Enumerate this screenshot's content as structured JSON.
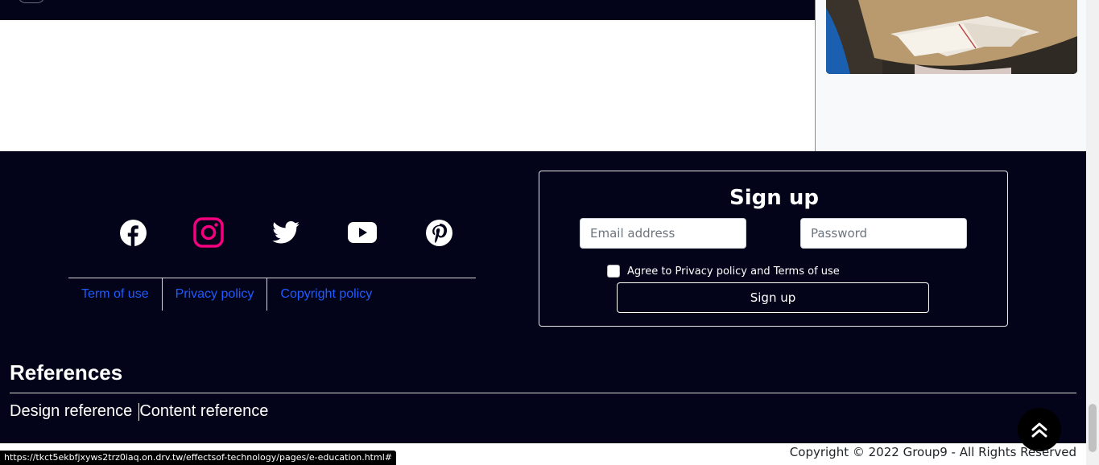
{
  "header": {
    "logo_icon": "site-logo-icon"
  },
  "sidebar": {
    "image_icon": "classroom-study-photo"
  },
  "footer": {
    "social": [
      {
        "name": "facebook",
        "icon": "facebook-icon",
        "color": "#ffffff"
      },
      {
        "name": "instagram",
        "icon": "instagram-icon",
        "color": "#f5007e"
      },
      {
        "name": "twitter",
        "icon": "twitter-icon",
        "color": "#ffffff"
      },
      {
        "name": "youtube",
        "icon": "youtube-icon",
        "color": "#ffffff"
      },
      {
        "name": "pinterest",
        "icon": "pinterest-icon",
        "color": "#ffffff"
      }
    ],
    "links": [
      {
        "label": "Term of use"
      },
      {
        "label": "Privacy policy"
      },
      {
        "label": "Copyright policy"
      }
    ],
    "link_color": "#1e5cff",
    "background": "#03031a"
  },
  "signup": {
    "title": "Sign up",
    "email_placeholder": "Email address",
    "password_placeholder": "Password",
    "agree_label": "Agree to Privacy policy and Terms of use",
    "button_label": "Sign up"
  },
  "references": {
    "title": "References",
    "links": [
      {
        "label": "Design reference"
      },
      {
        "label": "Content reference"
      }
    ]
  },
  "back_to_top": {
    "icon": "double-chevron-up-icon"
  },
  "copyright": "Copyright © 2022 Group9 - All Rights Reserved",
  "status_bar": {
    "url": "https://tkct5ekbfjxyws2trz0iaq.on.drv.tw/effectsof-technology/pages/e-education.html#"
  }
}
